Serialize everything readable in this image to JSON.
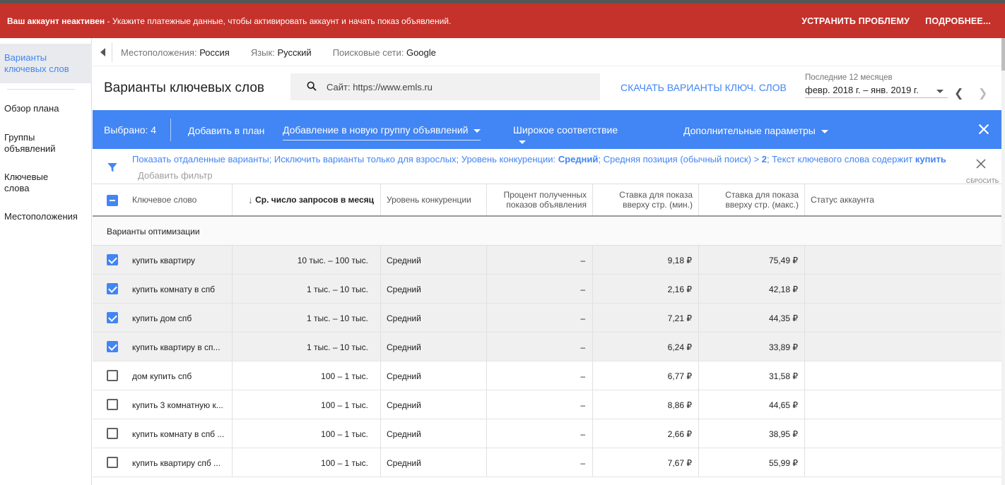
{
  "alert": {
    "title": "Ваш аккаунт неактивен",
    "message": " - Укажите платежные данные, чтобы активировать аккаунт и начать показ объявлений.",
    "fix": "УСТРАНИТЬ ПРОБЛЕМУ",
    "more": "ПОДРОБНЕЕ..."
  },
  "sidenav": {
    "items": [
      {
        "label": "Варианты ключевых слов"
      },
      {
        "label": "Обзор плана"
      },
      {
        "label": "Группы объявлений"
      },
      {
        "label": "Ключевые слова"
      },
      {
        "label": "Местоположения"
      }
    ]
  },
  "topbar": {
    "loc_label": "Местоположения:",
    "loc_value": "Россия",
    "lang_label": "Язык:",
    "lang_value": "Русский",
    "net_label": "Поисковые сети:",
    "net_value": "Google"
  },
  "header": {
    "title": "Варианты ключевых слов",
    "search_value": "Сайт: https://www.emls.ru",
    "download": "СКАЧАТЬ ВАРИАНТЫ КЛЮЧ. СЛОВ",
    "period_label": "Последние 12 месяцев",
    "period_value": "февр. 2018 г. – янв. 2019 г."
  },
  "selbar": {
    "count": "Выбрано: 4",
    "add": "Добавить в план",
    "group_dd": "Добавление в новую группу объявлений",
    "match_dd": "Широкое соответствие",
    "more": "Дополнительные параметры"
  },
  "filters": {
    "t1": "Показать отдаленные варианты; Исключить варианты только для взрослых; Уровень конкуренции: ",
    "b1": "Средний",
    "t2": "; Средняя позиция (обычный поиск) > ",
    "b2": "2",
    "t3": "; Текст ключевого слова содержит ",
    "b3": "купить",
    "add_filter": "Добавить фильтр",
    "reset": "СБРОСИТЬ"
  },
  "table": {
    "headers": {
      "keyword": "Ключевое слово",
      "searches": "Ср. число запросов в месяц",
      "competition": "Уровень конкуренции",
      "impr_share_1": "Процент полученных",
      "impr_share_2": "показов объявления",
      "bid_low_1": "Ставка для показа",
      "bid_low_2": "вверху стр. (мин.)",
      "bid_high_1": "Ставка для показа",
      "bid_high_2": "вверху стр. (макс.)",
      "status": "Статус аккаунта"
    },
    "group_label": "Варианты оптимизации",
    "rows": [
      {
        "keyword": "купить квартиру",
        "searches": "10 тыс. – 100 тыс.",
        "competition": "Средний",
        "impr": "–",
        "low": "9,18 ₽",
        "high": "75,49 ₽",
        "checked": true
      },
      {
        "keyword": "купить комнату в спб",
        "searches": "1 тыс. – 10 тыс.",
        "competition": "Средний",
        "impr": "–",
        "low": "2,16 ₽",
        "high": "42,18 ₽",
        "checked": true
      },
      {
        "keyword": "купить дом спб",
        "searches": "1 тыс. – 10 тыс.",
        "competition": "Средний",
        "impr": "–",
        "low": "7,21 ₽",
        "high": "44,35 ₽",
        "checked": true
      },
      {
        "keyword": "купить квартиру в сп...",
        "searches": "1 тыс. – 10 тыс.",
        "competition": "Средний",
        "impr": "–",
        "low": "6,24 ₽",
        "high": "33,89 ₽",
        "checked": true
      },
      {
        "keyword": "дом купить спб",
        "searches": "100 – 1 тыс.",
        "competition": "Средний",
        "impr": "–",
        "low": "6,77 ₽",
        "high": "31,58 ₽",
        "checked": false
      },
      {
        "keyword": "купить 3 комнатную к...",
        "searches": "100 – 1 тыс.",
        "competition": "Средний",
        "impr": "–",
        "low": "8,86 ₽",
        "high": "44,65 ₽",
        "checked": false
      },
      {
        "keyword": "купить комнату в спб ...",
        "searches": "100 – 1 тыс.",
        "competition": "Средний",
        "impr": "–",
        "low": "2,66 ₽",
        "high": "38,95 ₽",
        "checked": false
      },
      {
        "keyword": "купить квартиру спб ...",
        "searches": "100 – 1 тыс.",
        "competition": "Средний",
        "impr": "–",
        "low": "7,67 ₽",
        "high": "55,99 ₽",
        "checked": false
      }
    ]
  },
  "colors": {
    "alert": "#c5312b",
    "accent": "#4285f4"
  }
}
